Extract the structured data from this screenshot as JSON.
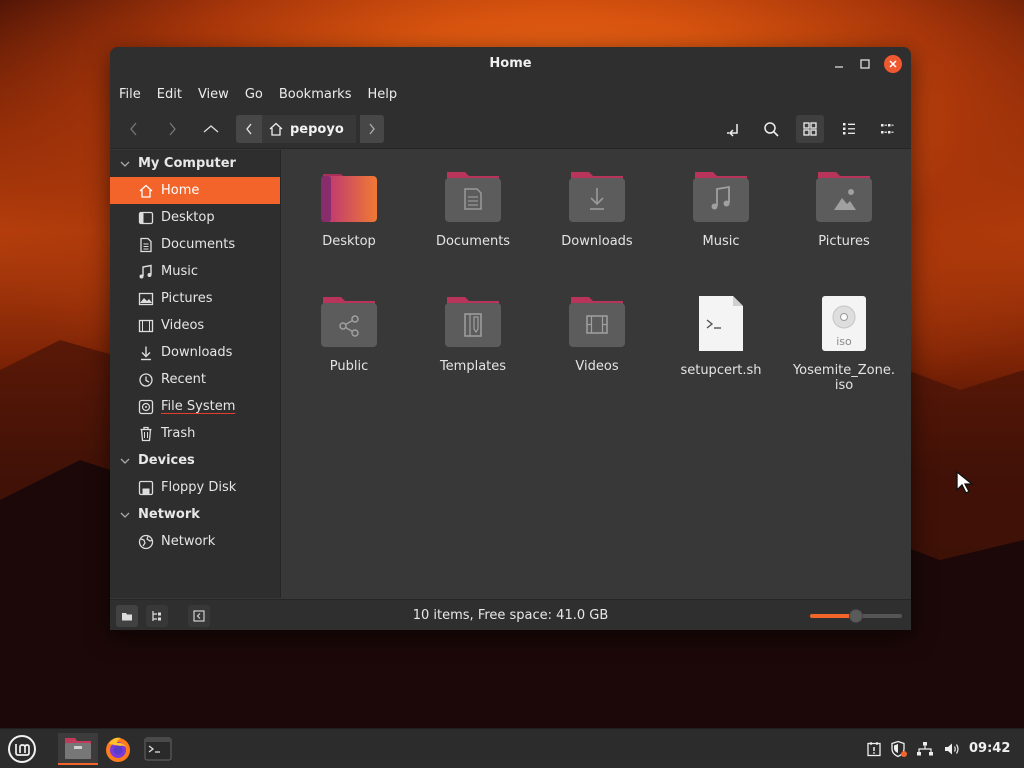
{
  "window": {
    "title": "Home",
    "menu": [
      "File",
      "Edit",
      "View",
      "Go",
      "Bookmarks",
      "Help"
    ]
  },
  "toolbar": {
    "breadcrumb": "pepoyo"
  },
  "sidebar": {
    "sections": [
      {
        "title": "My Computer",
        "items": [
          {
            "label": "Home",
            "icon": "home-icon",
            "active": true
          },
          {
            "label": "Desktop",
            "icon": "desktop-icon"
          },
          {
            "label": "Documents",
            "icon": "documents-icon"
          },
          {
            "label": "Music",
            "icon": "music-icon"
          },
          {
            "label": "Pictures",
            "icon": "pictures-icon"
          },
          {
            "label": "Videos",
            "icon": "videos-icon"
          },
          {
            "label": "Downloads",
            "icon": "downloads-icon"
          },
          {
            "label": "Recent",
            "icon": "recent-icon"
          },
          {
            "label": "File System",
            "icon": "filesystem-icon"
          },
          {
            "label": "Trash",
            "icon": "trash-icon"
          }
        ]
      },
      {
        "title": "Devices",
        "items": [
          {
            "label": "Floppy Disk",
            "icon": "floppy-icon"
          }
        ]
      },
      {
        "title": "Network",
        "items": [
          {
            "label": "Network",
            "icon": "network-icon"
          }
        ]
      }
    ]
  },
  "files": [
    {
      "name": "Desktop",
      "type": "folder"
    },
    {
      "name": "Documents",
      "type": "folder"
    },
    {
      "name": "Downloads",
      "type": "folder"
    },
    {
      "name": "Music",
      "type": "folder"
    },
    {
      "name": "Pictures",
      "type": "folder"
    },
    {
      "name": "Public",
      "type": "folder"
    },
    {
      "name": "Templates",
      "type": "folder"
    },
    {
      "name": "Videos",
      "type": "folder"
    },
    {
      "name": "setupcert.sh",
      "type": "script"
    },
    {
      "name": "Yosemite_Zone.\niso",
      "type": "iso"
    }
  ],
  "iso_badge": "iso",
  "statusbar": {
    "text": "10 items, Free space: 41.0 GB",
    "zoom_level": 0.5
  },
  "taskbar": {
    "clock": "09:42"
  },
  "colors": {
    "accent": "#f2642a",
    "folder_top": "#b8345a",
    "folder_body": "#5a5a5a"
  }
}
